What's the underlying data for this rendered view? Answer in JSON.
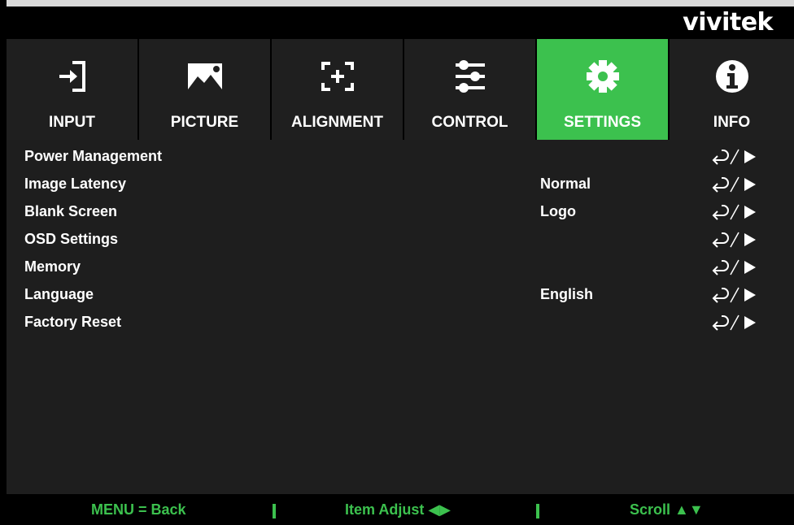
{
  "brand": "vivitek",
  "tabs": [
    {
      "label": "INPUT",
      "icon": "input-icon",
      "active": false
    },
    {
      "label": "PICTURE",
      "icon": "picture-icon",
      "active": false
    },
    {
      "label": "ALIGNMENT",
      "icon": "alignment-icon",
      "active": false
    },
    {
      "label": "CONTROL",
      "icon": "control-sliders-icon",
      "active": false
    },
    {
      "label": "SETTINGS",
      "icon": "gear-icon",
      "active": true
    },
    {
      "label": "INFO",
      "icon": "info-icon",
      "active": false
    }
  ],
  "rows": [
    {
      "name": "Power Management",
      "value": ""
    },
    {
      "name": "Image Latency",
      "value": "Normal"
    },
    {
      "name": "Blank Screen",
      "value": "Logo"
    },
    {
      "name": "OSD Settings",
      "value": ""
    },
    {
      "name": "Memory",
      "value": ""
    },
    {
      "name": "Language",
      "value": "English"
    },
    {
      "name": "Factory Reset",
      "value": ""
    }
  ],
  "footer": {
    "back": "MENU = Back",
    "adjust": "Item Adjust ◀▶",
    "scroll": "Scroll ▲▼"
  },
  "colors": {
    "accent": "#3cc14e",
    "tab_bg": "#1f1f1f",
    "content_bg": "#1e1e1e",
    "frame_bg": "#000000"
  }
}
